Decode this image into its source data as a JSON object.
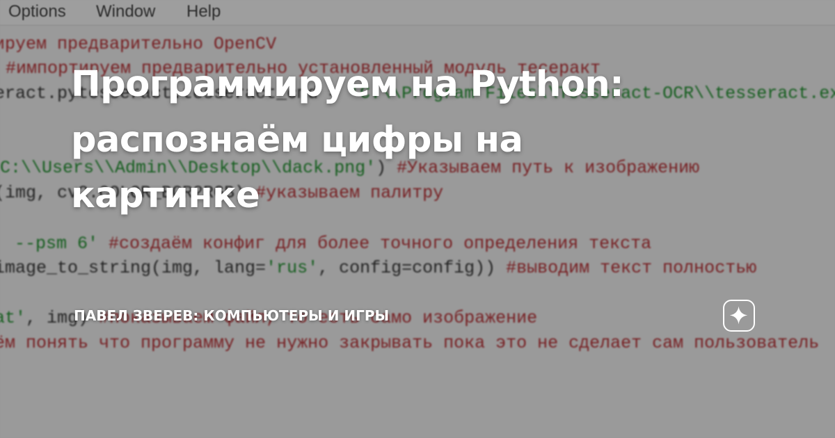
{
  "menubar": {
    "items": [
      "Options",
      "Window",
      "Help"
    ]
  },
  "code_lines": [
    [
      {
        "kind": "comment",
        "text": "ируем предварительно OpenCV"
      }
    ],
    [
      {
        "kind": "comment",
        "text": "#импортируем предварительно установленный модуль тесеракт"
      }
    ],
    [
      {
        "kind": "plain",
        "text": "eract.pytesseract.tesseract_cmd = "
      },
      {
        "kind": "string",
        "text": "'C:\\\\Program Files\\\\Tesseract-OCR\\\\tesseract.exe'"
      }
    ],
    [
      {
        "kind": "string",
        "text": "C:\\\\Users\\\\Admin\\\\Desktop\\\\dack.png'"
      },
      {
        "kind": "plain",
        "text": ") "
      },
      {
        "kind": "comment",
        "text": "#Указываем путь к изображению"
      }
    ],
    [
      {
        "kind": "plain",
        "text": "(img, cv2.COLOR_BGR2RGB) "
      },
      {
        "kind": "comment",
        "text": "#указываем палитру"
      }
    ],
    [
      {
        "kind": "string",
        "text": " --psm 6' "
      },
      {
        "kind": "comment",
        "text": "#создаём конфиг для более точного определения текста"
      }
    ],
    [
      {
        "kind": "plain",
        "text": "image_to_string(img, lang="
      },
      {
        "kind": "string",
        "text": "'rus'"
      },
      {
        "kind": "plain",
        "text": ", config=config)) "
      },
      {
        "kind": "comment",
        "text": "#выводим текст полностью"
      }
    ],
    [
      {
        "kind": "string",
        "text": "at'"
      },
      {
        "kind": "plain",
        "text": ", img) "
      },
      {
        "kind": "comment",
        "text": "#показываем файл, то есть само изображение"
      }
    ],
    [
      {
        "kind": "comment",
        "text": "ём понять что программу не нужно закрывать пока это не сделает сам пользователь"
      }
    ]
  ],
  "article": {
    "title_lines": [
      "Программируем на Python:",
      "распознаём цифры на",
      "картинке"
    ],
    "channel": "ПАВЕЛ ЗВЕРЕВ: КОМПЬЮТЕРЫ И ИГРЫ"
  },
  "logo": {
    "icon": "sparkle-star-icon",
    "color": "#ffffff"
  },
  "colors": {
    "comment": "#b3262b",
    "string": "#168a25",
    "overlay": "#141414"
  }
}
